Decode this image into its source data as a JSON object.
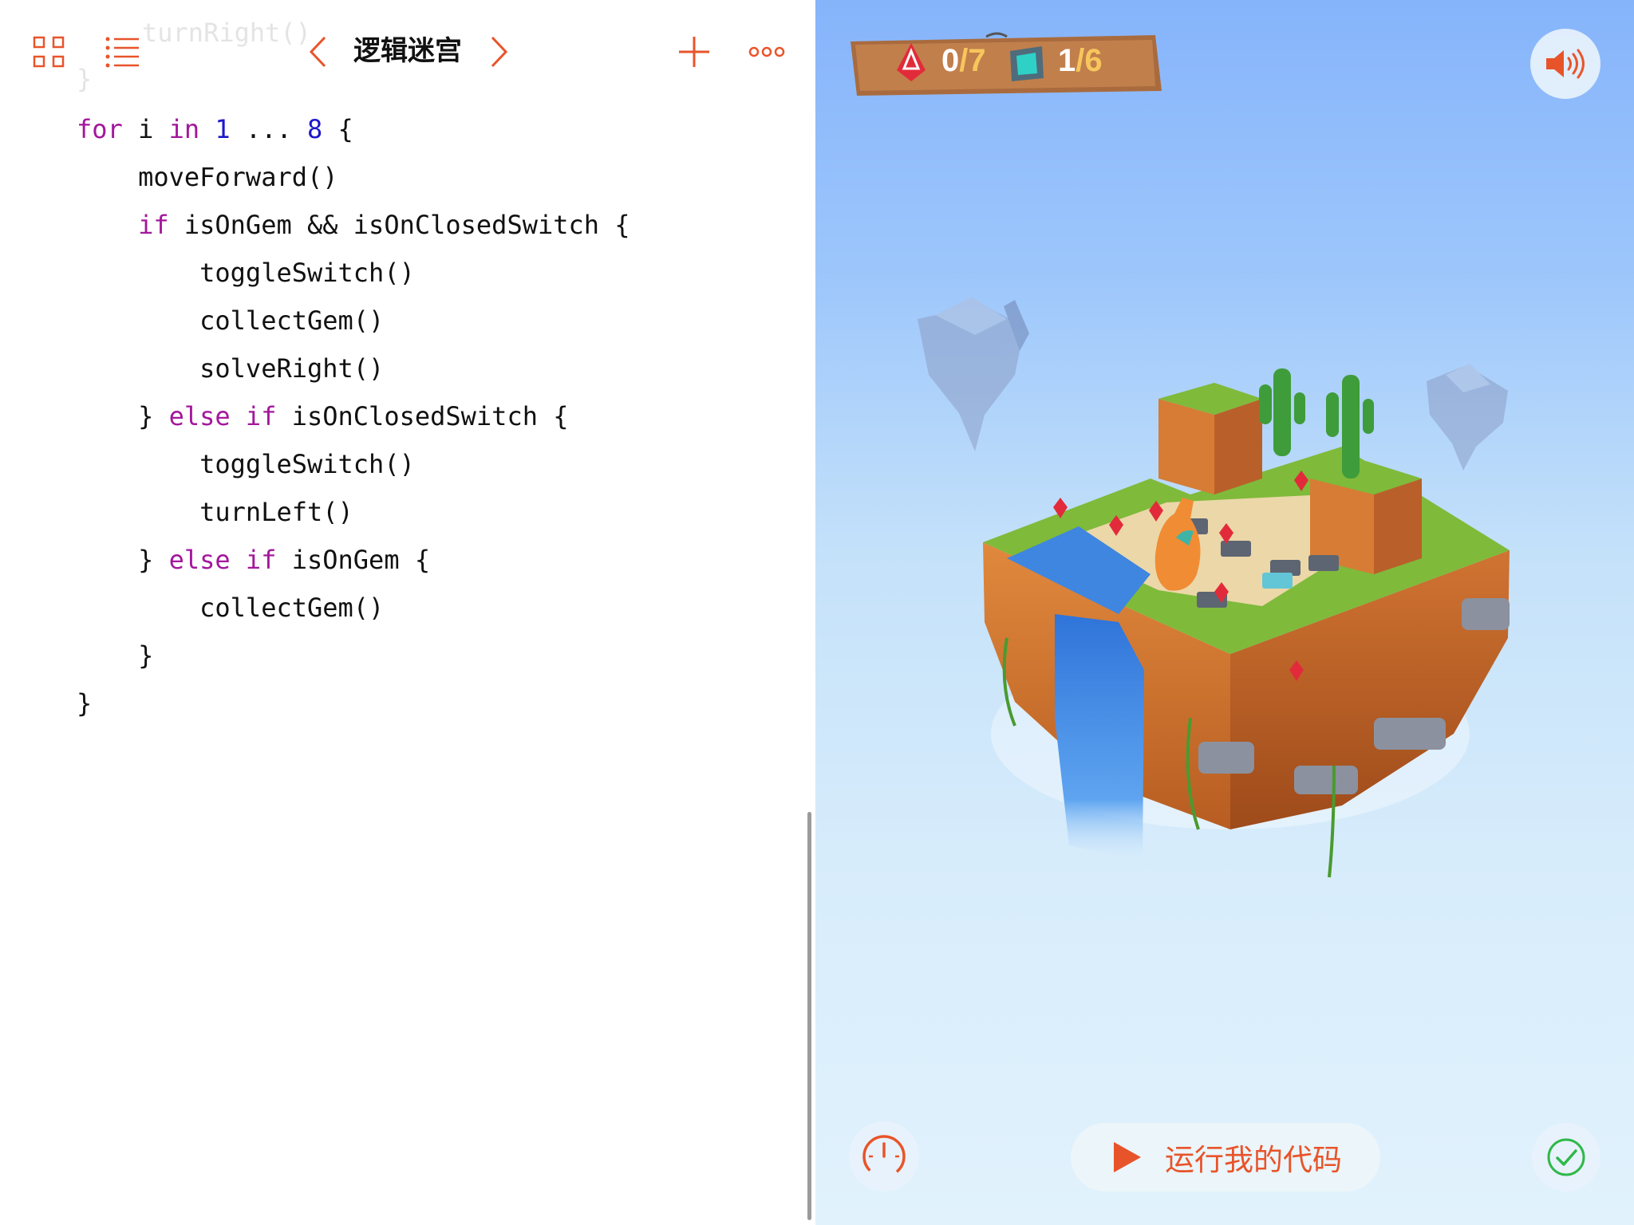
{
  "editor": {
    "title": "逻辑迷宫",
    "ghost_line_1": "turnRight()",
    "ghost_line_2": "}",
    "code": [
      [
        {
          "t": "for",
          "c": "kw"
        },
        {
          "t": " i "
        },
        {
          "t": "in",
          "c": "kw"
        },
        {
          "t": " "
        },
        {
          "t": "1",
          "c": "num"
        },
        {
          "t": " ... "
        },
        {
          "t": "8",
          "c": "num"
        },
        {
          "t": " {"
        }
      ],
      [
        {
          "t": "    moveForward()"
        }
      ],
      [
        {
          "t": "    "
        },
        {
          "t": "if",
          "c": "kw"
        },
        {
          "t": " isOnGem && isOnClosedSwitch {"
        }
      ],
      [
        {
          "t": "        toggleSwitch()"
        }
      ],
      [
        {
          "t": "        collectGem()"
        }
      ],
      [
        {
          "t": "        solveRight()"
        }
      ],
      [
        {
          "t": "    } "
        },
        {
          "t": "else if",
          "c": "kw"
        },
        {
          "t": " isOnClosedSwitch {"
        }
      ],
      [
        {
          "t": "        toggleSwitch()"
        }
      ],
      [
        {
          "t": "        turnLeft()"
        }
      ],
      [
        {
          "t": "    } "
        },
        {
          "t": "else if",
          "c": "kw"
        },
        {
          "t": " isOnGem {"
        }
      ],
      [
        {
          "t": "        collectGem()"
        }
      ],
      [
        {
          "t": "    }"
        }
      ],
      [
        {
          "t": "}"
        }
      ]
    ],
    "icons": {
      "grid": "grid-icon",
      "list": "list-icon",
      "prev": "chevron-left-icon",
      "next": "chevron-right-icon",
      "add": "plus-icon",
      "more": "more-icon"
    }
  },
  "scene": {
    "gems_collected": "0",
    "gems_total": "/7",
    "switches_on": "1",
    "switches_total": "/6",
    "run_button_label": "运行我的代码",
    "icons": {
      "gem": "gem-icon",
      "switch": "switch-icon",
      "sound": "speaker-icon",
      "speed": "speedometer-icon",
      "play": "play-icon",
      "check": "checkmark-icon"
    }
  },
  "colors": {
    "accent": "#e8542a",
    "keyword": "#a3179c",
    "number": "#1d18c9",
    "check_green": "#2fb84a",
    "sky_top": "#86b4fb"
  }
}
